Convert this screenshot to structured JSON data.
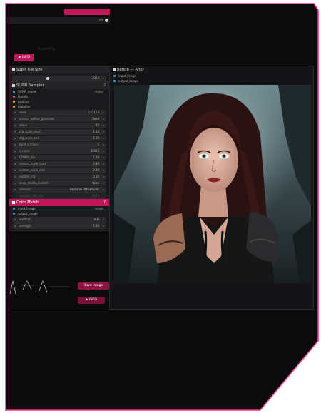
{
  "colors": {
    "accent": "#e91e63",
    "node_bg": "#1b1b1d",
    "canvas_bg": "#0c0c0d",
    "port_blue": "#3fa9f5"
  },
  "top_bar": {
    "toggle_label": "on"
  },
  "canvas_label": "SuperPrig",
  "info_button_top": "INFO",
  "tile_size_node": {
    "title": "Supir Tile Size",
    "value": "1024"
  },
  "sampler_node": {
    "title": "SUPIR Sampler",
    "model_label": "SUPIR_model",
    "model_value": "model",
    "ports": [
      "latents",
      "positive",
      "negative"
    ],
    "params": [
      {
        "label": "seed",
        "value": "123123"
      },
      {
        "label": "control_before_generate",
        "value": "fixed"
      },
      {
        "label": "steps",
        "value": "65"
      },
      {
        "label": "cfg_scale_start",
        "value": "4.50"
      },
      {
        "label": "cfg_scale_end",
        "value": "7.00"
      },
      {
        "label": "EDM_s_churn",
        "value": "5"
      },
      {
        "label": "s_noise",
        "value": "1.003"
      },
      {
        "label": "DPMPP_eta",
        "value": "1.00"
      },
      {
        "label": "control_scale_start",
        "value": "0.80"
      },
      {
        "label": "control_scale_end",
        "value": "0.90"
      },
      {
        "label": "restore_cfg",
        "value": "0.10"
      },
      {
        "label": "keep_model_loaded",
        "value": "false"
      },
      {
        "label": "sampler",
        "value": "RestoreEDMSampler"
      }
    ],
    "disabled_rows": [
      {
        "label": "sampler_tile_size",
        "value": "1024"
      },
      {
        "label": "sampler_tile_stride",
        "value": "512"
      }
    ]
  },
  "color_match_node": {
    "title": "Color Match",
    "inputs": [
      {
        "label": "input_image",
        "value": "image"
      },
      {
        "label": "output_image",
        "value": ""
      }
    ],
    "params": [
      {
        "label": "method",
        "value": "mkl"
      },
      {
        "label": "strength",
        "value": "1.00"
      }
    ]
  },
  "before_after_node": {
    "title": "Before — After",
    "inputs": [
      "input_image",
      "output_image"
    ]
  },
  "save_image_button": "Save Image",
  "info_button_bottom": "INFO"
}
